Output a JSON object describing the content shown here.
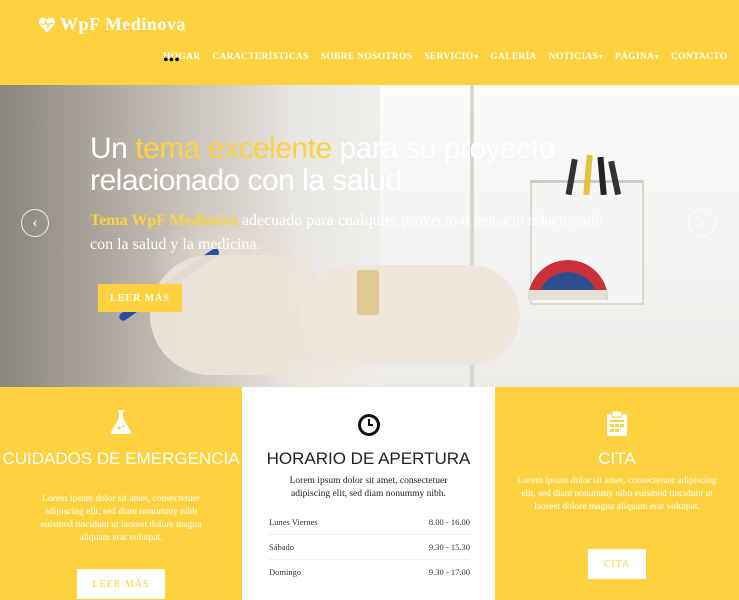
{
  "brand": {
    "name": "WpF Medinova"
  },
  "nav": {
    "items": [
      {
        "label": "HOGAR",
        "caret": false
      },
      {
        "label": "CARACTERÍSTICAS",
        "caret": false
      },
      {
        "label": "SOBRE NOSOTROS",
        "caret": false
      },
      {
        "label": "SERVICIO",
        "caret": true
      },
      {
        "label": "GALERÍA",
        "caret": false
      },
      {
        "label": "NOTICIAS",
        "caret": true
      },
      {
        "label": "PÁGINA",
        "caret": true
      },
      {
        "label": "CONTACTO",
        "caret": false
      }
    ],
    "active_marker": "•••"
  },
  "hero": {
    "title_part1": "Un ",
    "title_highlight": "tema excelente",
    "title_part2": " para su proyecto relacionado con la salud",
    "subtitle_highlight": "Tema WpF Medinova",
    "subtitle_rest": " adecuado para cualquier proyecto o negocio relacionado con la salud y la medicina.",
    "button_label": "LEER MÁS",
    "prev_arrow": "‹",
    "next_arrow": "›"
  },
  "cards": {
    "emergency": {
      "icon": "flask-icon",
      "heading": "CUIDADOS DE EMERGENCIA",
      "body": "Lorem ipsum dolor sit amet, consectetuer adipiscing elit, sed diam nonummy nibh euismod tincidunt ut laoreet dolore magna aliquam erat volutpat.",
      "button": "LEER MÁS"
    },
    "hours": {
      "icon": "clock-icon",
      "heading": "HORARIO DE APERTURA",
      "body": "Lorem ipsum dolor sit amet, consectetuer adipiscing elit, sed diam nonummy nibh.",
      "rows": [
        {
          "day": "Lunes Viernes",
          "time": "8.00 - 16.00"
        },
        {
          "day": "Sábado",
          "time": "9.30 - 15.30"
        },
        {
          "day": "Domingo",
          "time": "9.30 - 17.00"
        }
      ]
    },
    "appointment": {
      "icon": "calendar-icon",
      "heading": "CITA",
      "body": "Lorem ipsum dolor sit amet, consectetuer adipiscing elit, sed diam nonummy nibh euismod tincidunt ut laoreet dolore magna aliquam erat volutpat.",
      "button": "CITA"
    }
  },
  "colors": {
    "accent": "#fdd23e",
    "white": "#ffffff",
    "dark": "#222222"
  }
}
